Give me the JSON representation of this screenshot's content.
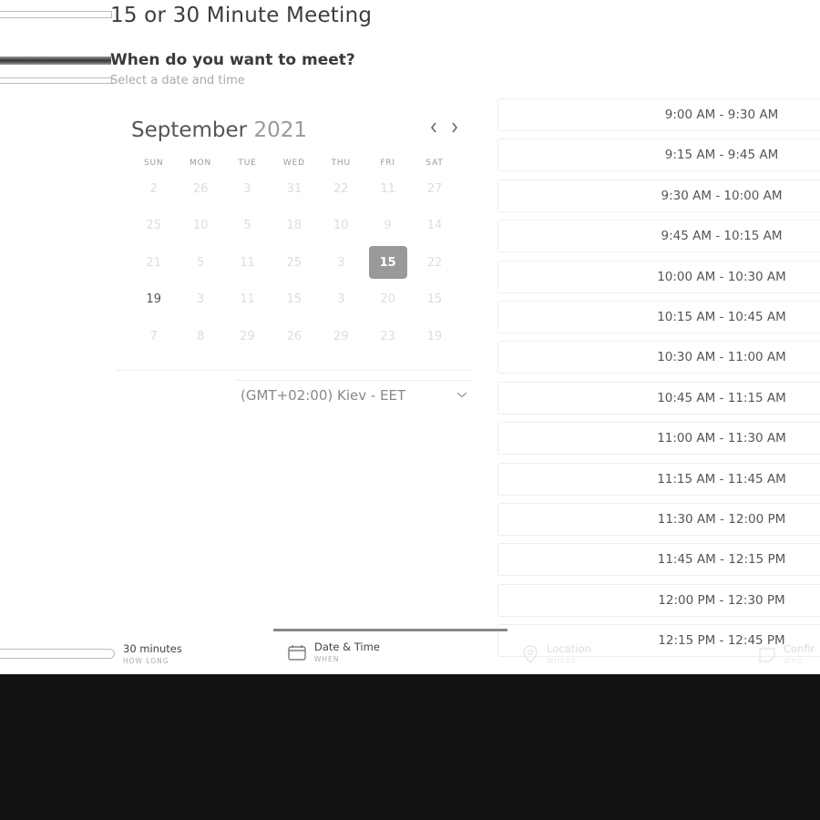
{
  "header": {
    "title": "15 or 30 Minute Meeting",
    "question": "When do you want to meet?",
    "subtext": "Select a date and time"
  },
  "calendar": {
    "month": "September",
    "year": "2021",
    "prev_label": "‹",
    "next_label": "›",
    "weekdays": [
      "SUN",
      "MON",
      "TUE",
      "WED",
      "THU",
      "FRI",
      "SAT"
    ],
    "weeks": [
      [
        {
          "d": "2",
          "s": "off"
        },
        {
          "d": "26",
          "s": "off"
        },
        {
          "d": "3",
          "s": "off"
        },
        {
          "d": "31",
          "s": "off"
        },
        {
          "d": "22",
          "s": "off"
        },
        {
          "d": "11",
          "s": "off"
        },
        {
          "d": "27",
          "s": "off"
        }
      ],
      [
        {
          "d": "25",
          "s": "off"
        },
        {
          "d": "10",
          "s": "off"
        },
        {
          "d": "5",
          "s": "off"
        },
        {
          "d": "18",
          "s": "off"
        },
        {
          "d": "10",
          "s": "off"
        },
        {
          "d": "9",
          "s": "off"
        },
        {
          "d": "14",
          "s": "off"
        }
      ],
      [
        {
          "d": "21",
          "s": "off"
        },
        {
          "d": "5",
          "s": "off"
        },
        {
          "d": "11",
          "s": "off"
        },
        {
          "d": "25",
          "s": "off"
        },
        {
          "d": "3",
          "s": "off"
        },
        {
          "d": "15",
          "s": "selected"
        },
        {
          "d": "22",
          "s": "off"
        }
      ],
      [
        {
          "d": "19",
          "s": "active"
        },
        {
          "d": "3",
          "s": "off"
        },
        {
          "d": "11",
          "s": "off"
        },
        {
          "d": "15",
          "s": "off"
        },
        {
          "d": "3",
          "s": "off"
        },
        {
          "d": "20",
          "s": "off"
        },
        {
          "d": "15",
          "s": "off"
        }
      ],
      [
        {
          "d": "7",
          "s": "off"
        },
        {
          "d": "8",
          "s": "off"
        },
        {
          "d": "29",
          "s": "off"
        },
        {
          "d": "26",
          "s": "off"
        },
        {
          "d": "29",
          "s": "off"
        },
        {
          "d": "23",
          "s": "off"
        },
        {
          "d": "19",
          "s": "off"
        }
      ]
    ],
    "timezone": "(GMT+02:00) Kiev - EET"
  },
  "slots": [
    "9:00 AM - 9:30 AM",
    "9:15 AM - 9:45 AM",
    "9:30 AM - 10:00 AM",
    "9:45 AM - 10:15 AM",
    "10:00 AM - 10:30 AM",
    "10:15 AM - 10:45 AM",
    "10:30 AM - 11:00 AM",
    "10:45 AM - 11:15 AM",
    "11:00 AM - 11:30 AM",
    "11:15 AM - 11:45 AM",
    "11:30 AM - 12:00 PM",
    "11:45 AM - 12:15 PM",
    "12:00 PM - 12:30 PM",
    "12:15 PM - 12:45 PM"
  ],
  "steps": {
    "duration": {
      "label": "30 minutes",
      "sub": "HOW LONG"
    },
    "datetime": {
      "label": "Date & Time",
      "sub": "WHEN"
    },
    "location": {
      "label": "Location",
      "sub": "WHERE"
    },
    "confirm": {
      "label": "Confir",
      "sub": "WHO"
    }
  },
  "colors": {
    "selected_day": "#999999",
    "background_bottom": "#121212"
  }
}
